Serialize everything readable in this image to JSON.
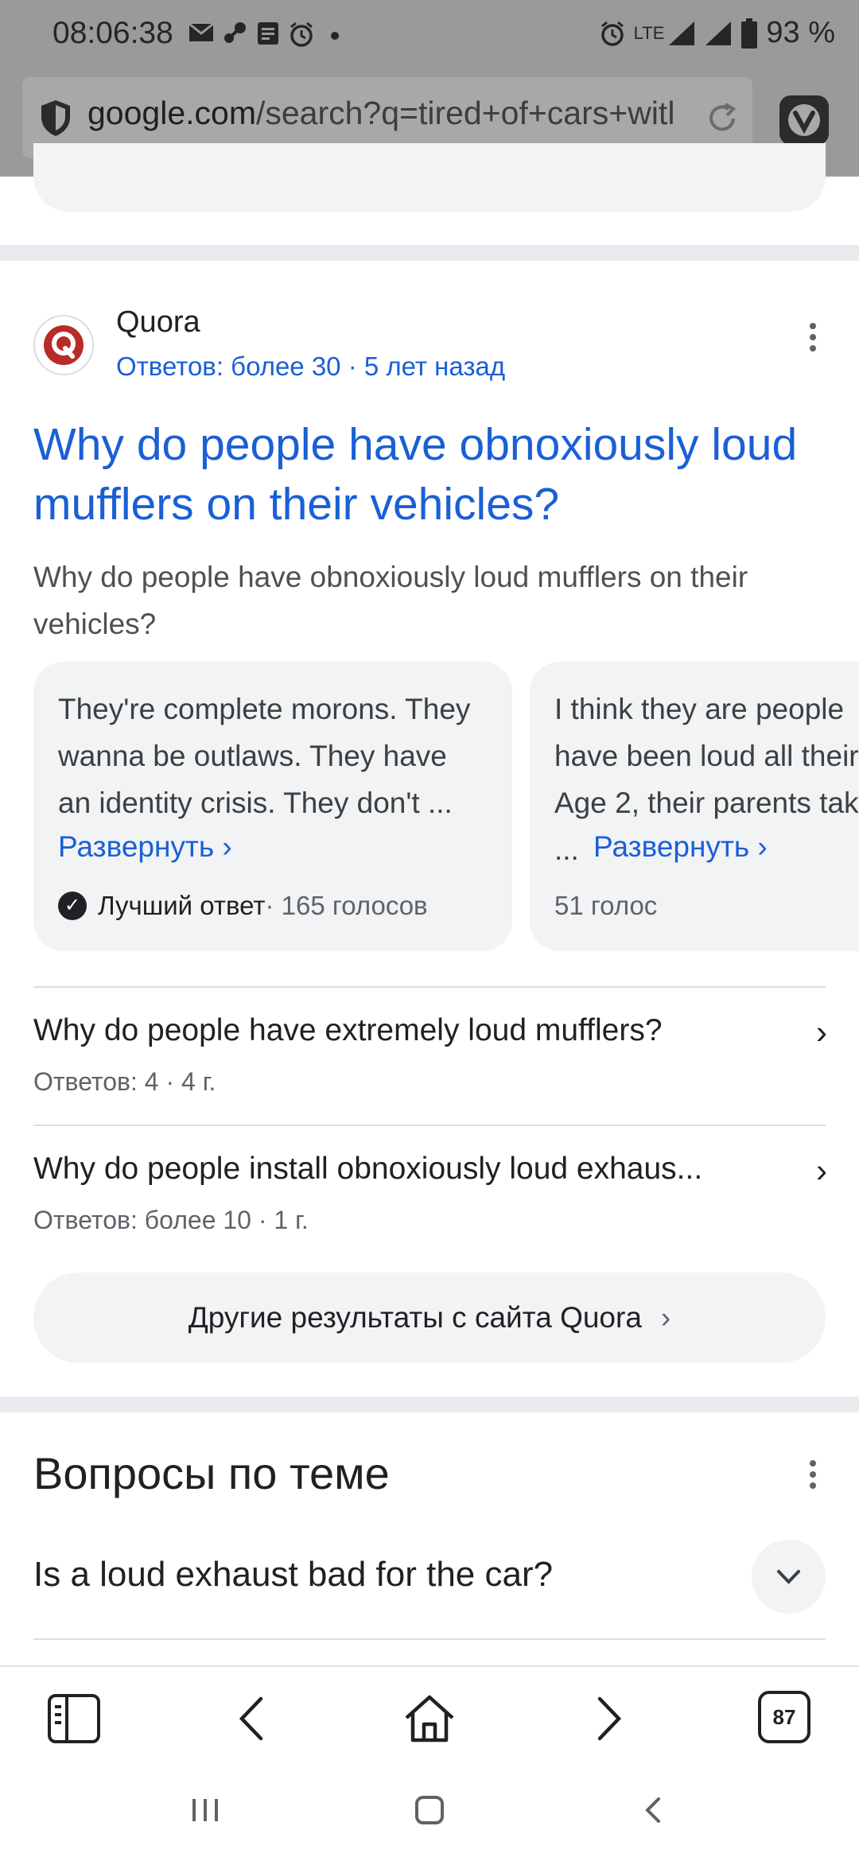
{
  "status_bar": {
    "time": "08:06:38",
    "network": "LTE",
    "battery": "93 %"
  },
  "url_bar": {
    "domain": "google.com",
    "path": "/search?q=tired+of+cars+witl"
  },
  "quora_result": {
    "source": "Quora",
    "meta": "Ответов: более 30 · 5 лет назад",
    "title": "Why do people have obnoxiously loud mufflers on their vehicles?",
    "snippet": "Why do people have obnoxiously loud mufflers on their vehicles?",
    "answers": [
      {
        "text": "They're complete morons. They\nwanna be outlaws. They have\nan identity crisis. They don't ...",
        "expand": "Развернуть ›",
        "badge": "Лучший ответ",
        "votes": " · 165 голосов"
      },
      {
        "text": "I think they are people\nhave been loud all their\nAge 2, their parents tak\n... ",
        "expand": "Развернуть ›",
        "votes": "51 голос"
      }
    ],
    "related": [
      {
        "title": "Why do people have extremely loud mufflers?",
        "meta": "Ответов: 4 · 4 г."
      },
      {
        "title": "Why do people install obnoxiously loud exhaus...",
        "meta": "Ответов: более 10 · 1 г."
      }
    ],
    "more_button": "Другие результаты с сайта Quora"
  },
  "people_also_ask": {
    "title": "Вопросы по теме",
    "question": "Is a loud exhaust bad for the car?"
  },
  "toolbar": {
    "tabs_count": "87"
  }
}
